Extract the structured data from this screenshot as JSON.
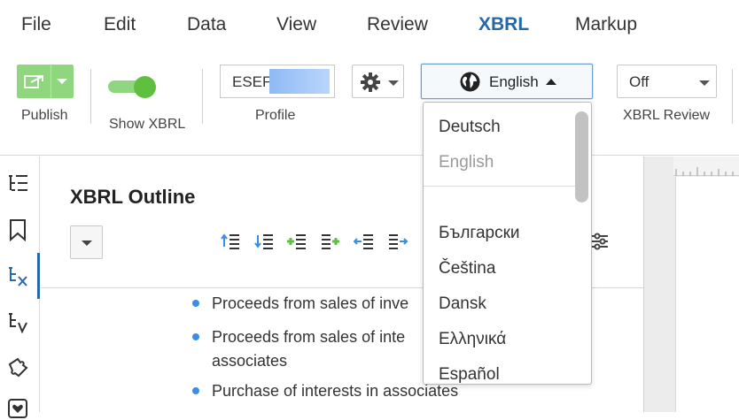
{
  "menu": {
    "items": [
      "File",
      "Edit",
      "Data",
      "View",
      "Review",
      "XBRL",
      "Markup"
    ],
    "active": "XBRL"
  },
  "toolbar": {
    "publish_label": "Publish",
    "show_xbrl_label": "Show XBRL",
    "show_xbrl_on": true,
    "profile_label": "Profile",
    "profile_value": "ESEF",
    "language_value": "English",
    "xbrl_review_label": "XBRL Review",
    "xbrl_review_value": "Off"
  },
  "language_dropdown": {
    "options": [
      "Deutsch",
      "English",
      "Български",
      "Čeština",
      "Dansk",
      "Ελληνικά",
      "Español"
    ],
    "selected": "English"
  },
  "panel": {
    "title": "XBRL Outline",
    "items": [
      "Proceeds from sales of inve",
      "Proceeds from sales of inte",
      "associates",
      "Purchase of interests in associates"
    ]
  },
  "icons": {
    "publish": "publish-icon",
    "settings": "gear-icon",
    "language": "globe-icon",
    "rail": [
      "outline-list-icon",
      "bookmark-icon",
      "xbrl-tag-icon",
      "validation-icon",
      "puzzle-icon",
      "heart-icon"
    ],
    "outline_tools": [
      "move-up-icon",
      "move-down-icon",
      "add-above-icon",
      "add-below-icon",
      "outdent-icon",
      "indent-icon"
    ]
  },
  "colors": {
    "accent": "#2668a8",
    "green": "#8fd67e",
    "bullet": "#3a8ee6"
  }
}
